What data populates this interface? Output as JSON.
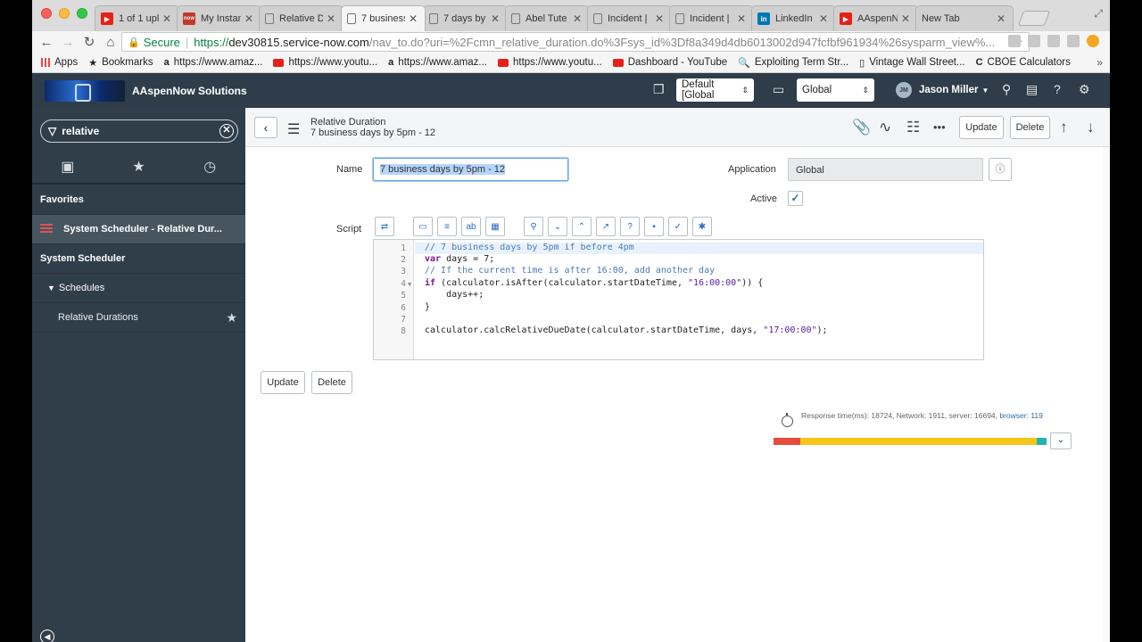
{
  "browser": {
    "tabs": [
      {
        "title": "1 of 1 upl",
        "icon": "youtube-icon"
      },
      {
        "title": "My Instanc",
        "icon": "now-icon"
      },
      {
        "title": "Relative D",
        "icon": "document-icon"
      },
      {
        "title": "7 business",
        "icon": "document-icon",
        "active": true
      },
      {
        "title": "7 days by",
        "icon": "document-icon"
      },
      {
        "title": "Abel Tute",
        "icon": "document-icon"
      },
      {
        "title": "Incident |",
        "icon": "document-icon"
      },
      {
        "title": "Incident |",
        "icon": "document-icon"
      },
      {
        "title": "LinkedIn",
        "icon": "linkedin-icon"
      },
      {
        "title": "AAspenNo",
        "icon": "youtube-icon"
      },
      {
        "title": "New Tab",
        "icon": ""
      }
    ],
    "address": {
      "secure_label": "Secure",
      "scheme": "https://",
      "host": "dev30815.service-now.com",
      "path": "/nav_to.do?uri=%2Fcmn_relative_duration.do%3Fsys_id%3Df8a349d4db6013002d947fcfbf961934%26sysparm_view%..."
    },
    "bookmarks": [
      {
        "label": "Apps",
        "icon": "apps-icon"
      },
      {
        "label": "Bookmarks",
        "icon": "star-icon"
      },
      {
        "label": "https://www.amaz...",
        "icon": "amazon-icon"
      },
      {
        "label": "https://www.youtu...",
        "icon": "youtube-icon"
      },
      {
        "label": "https://www.amaz...",
        "icon": "amazon-icon"
      },
      {
        "label": "https://www.youtu...",
        "icon": "youtube-icon"
      },
      {
        "label": "Dashboard - YouTube",
        "icon": "youtube-icon"
      },
      {
        "label": "Exploiting Term Str...",
        "icon": "search-icon"
      },
      {
        "label": "Vintage Wall Street...",
        "icon": "document-icon"
      },
      {
        "label": "CBOE Calculators",
        "icon": "cboe-icon"
      }
    ]
  },
  "header": {
    "brand": "AAspenNow Solutions",
    "update_set": "Default [Global",
    "scope": "Global",
    "user_initials": "JM",
    "user_name": "Jason Miller"
  },
  "sidebar": {
    "filter_value": "relative",
    "favorites_label": "Favorites",
    "favorite_item": "System Scheduler - Relative Dur...",
    "app_label": "System Scheduler",
    "module_label": "Schedules",
    "sub_item": "Relative Durations"
  },
  "form": {
    "table_label": "Relative Duration",
    "record_name": "7 business days by 5pm - 12",
    "update_label": "Update",
    "delete_label": "Delete",
    "name_label": "Name",
    "name_value": "7 business days by 5pm - 12",
    "application_label": "Application",
    "application_value": "Global",
    "active_label": "Active",
    "active_checked": true,
    "script_label": "Script"
  },
  "script": {
    "lines": [
      "// 7 business days by 5pm if before 4pm",
      "var days = 7;",
      "// If the current time is after 16:00, add another day",
      "if (calculator.isAfter(calculator.startDateTime, \"16:00:00\")) {",
      "    days++;",
      "}",
      "",
      "calculator.calcRelativeDueDate(calculator.startDateTime, days, \"17:00:00\");"
    ],
    "line_numbers": [
      "1",
      "2",
      "3",
      "4",
      "5",
      "6",
      "7",
      "8"
    ]
  },
  "response": {
    "text": "Response time(ms): 18724, Network: 1911, server: 16694, ",
    "browser_text": "browser: 119",
    "total_ms": 18724,
    "network_ms": 1911,
    "server_ms": 16694,
    "browser_ms": 119,
    "colors": {
      "network": "#e74c3c",
      "server": "#f5c518",
      "browser": "#1fb3b3"
    }
  }
}
